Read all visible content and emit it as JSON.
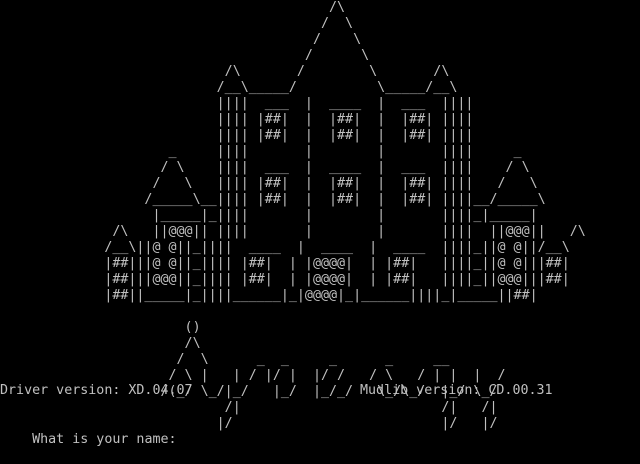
{
  "ascii_art": [
    "                                         /\\",
    "                                        /  \\",
    "                                       /    \\",
    "                                      /      \\",
    "                            /\\       /        \\       /\\",
    "                           /__\\_____/          \\_____/__\\",
    "                           ||||  ___  |  ____  |  ___  ||||",
    "                           |||| |##|  |  |##|  |  |##| ||||",
    "                           |||| |##|  |  |##|  |  |##| ||||",
    "                     _     ||||       |        |       ||||     _",
    "                    / \\    ||||  ___  |  ____  |  ___  ||||    / \\",
    "                   /   \\   |||| |##|  |  |##|  |  |##| ||||   /   \\",
    "                  /_____\\__|||| |##|  |  |##|  |  |##| ||||__/_____\\",
    "                   |_____|_||||       |        |       ||||_|_____|",
    "              /\\   ||@@@|| ||||       |        |       ||||  ||@@@||   /\\",
    "             /__\\||@ @||_||||  ____  |  ____  |  ____  ||||_||@ @||/__\\",
    "             |##|||@ @||_|||| |##|  | |@@@@|  | |##|   ||||_||@ @|||##|",
    "             |##|||@@@||_|||| |##|  | |@@@@|  | |##|   ||||_||@@@|||##|",
    "             |##||_____|_||||______|_|@@@@|_|______||||_|_____||##|",
    "",
    "                       ()",
    "                       /\\",
    "                      /  \\      _  _     _      _     __",
    "                     / \\ |   | / |/ |  |/ /   / \\   / | |  |  /",
    "                    /(_/ \\_/|_/   |_/  |_/_/   \\_/\\_/  |_/ \\_/",
    "                            /|                         /|   /|",
    "                           |/                          |/   |/"
  ],
  "status": {
    "driver_version": "Driver version: XD.04.07",
    "mudlib_version": "Mudlib version: CD.00.31"
  },
  "prompt": {
    "text": "What is your name: "
  },
  "colors": {
    "background": "#000000",
    "foreground": "#c0c0c0"
  }
}
